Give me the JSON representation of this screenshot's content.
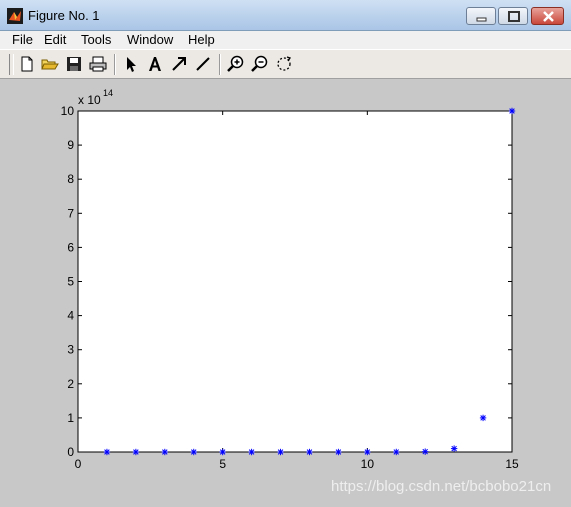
{
  "window": {
    "title": "Figure No. 1",
    "controls": {
      "minimize": "minimize-icon",
      "maximize": "maximize-icon",
      "close": "close-icon"
    }
  },
  "menubar": {
    "items": [
      "File",
      "Edit",
      "Tools",
      "Window",
      "Help"
    ]
  },
  "toolbar": {
    "buttons": [
      "new-file-icon",
      "open-folder-icon",
      "save-icon",
      "print-icon",
      "select-arrow-icon",
      "insert-text-icon",
      "insert-arrow-icon",
      "insert-line-icon",
      "zoom-in-icon",
      "zoom-out-icon",
      "rotate-icon"
    ]
  },
  "chart_data": {
    "type": "scatter",
    "marker": "*",
    "marker_color": "#0000ff",
    "x": [
      1,
      2,
      3,
      4,
      5,
      6,
      7,
      8,
      9,
      10,
      11,
      12,
      13,
      14,
      15
    ],
    "y": [
      10,
      100,
      1000,
      10000,
      100000,
      1000000,
      10000000,
      100000000,
      1000000000,
      10000000000,
      100000000000,
      1000000000000,
      10000000000000,
      100000000000000,
      1000000000000000
    ],
    "xlim": [
      0,
      15
    ],
    "ylim": [
      0,
      1000000000000000
    ],
    "xticks": [
      "0",
      "5",
      "10",
      "15"
    ],
    "yticks": [
      "0",
      "1",
      "2",
      "3",
      "4",
      "5",
      "6",
      "7",
      "8",
      "9",
      "10"
    ],
    "y_exponent_label": "x 10",
    "y_exponent_power": "14",
    "grid": false
  },
  "watermark": "https://blog.csdn.net/bcbobo21cn"
}
